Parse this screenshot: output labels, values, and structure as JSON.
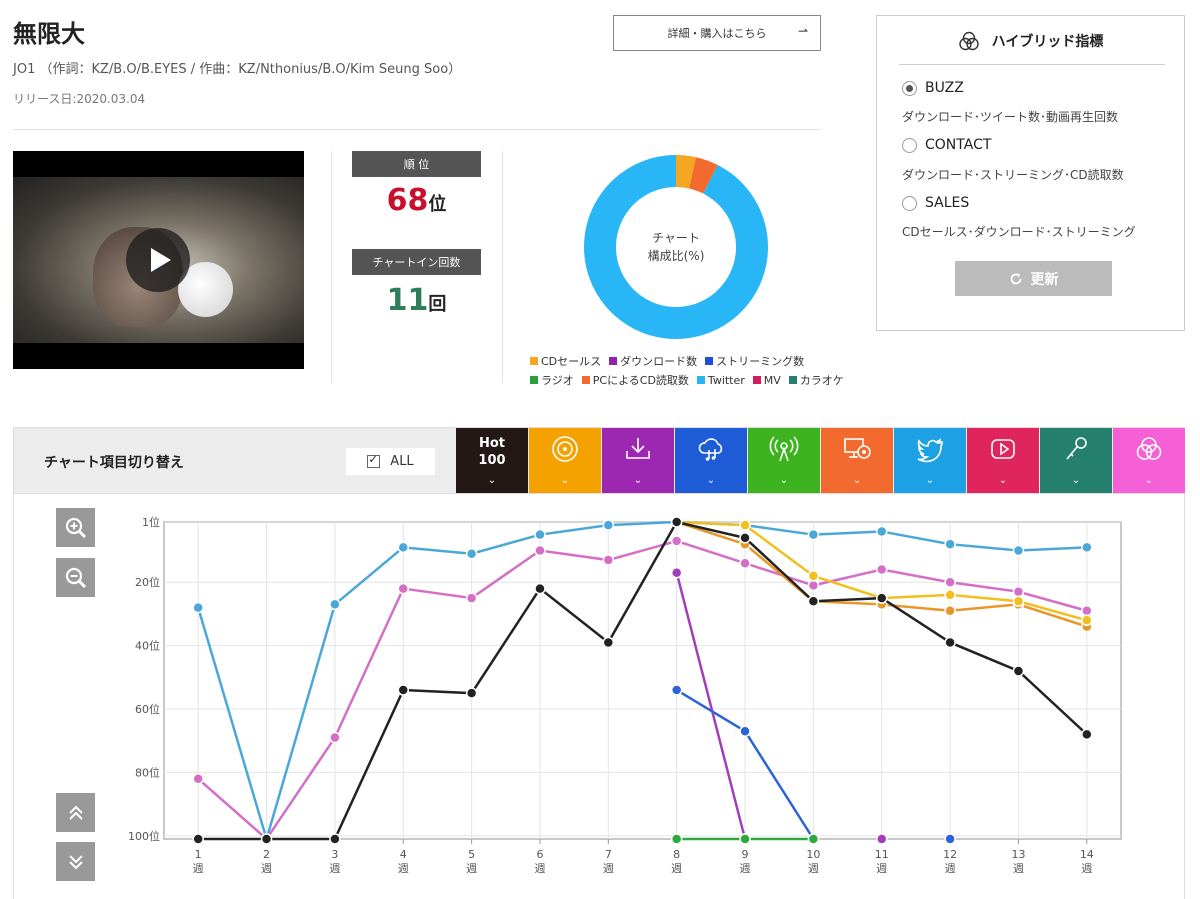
{
  "song": {
    "title": "無限大",
    "credits": "JO1 （作詞：KZ/B.O/B.EYES / 作曲：KZ/Nthonius/B.O/Kim Seung Soo）",
    "release": "リリース日:2020.03.04",
    "detail_button": "詳細・購入はこちら",
    "detail_arrow": "⇀"
  },
  "stats": {
    "rank_label": "順 位",
    "rank_value": "68",
    "rank_unit": "位",
    "chartin_label": "チャートイン回数",
    "chartin_value": "11",
    "chartin_unit": "回",
    "rank_color": "#c8102e",
    "chartin_color": "#2e7d5b"
  },
  "donut": {
    "center_line1": "チャート",
    "center_line2": "構成比(%)",
    "segments": [
      {
        "name": "CDセールス",
        "percent": 3.5,
        "color": "#f5a623"
      },
      {
        "name": "PCによるCD読取数",
        "percent": 4,
        "color": "#f26a2e"
      },
      {
        "name": "Twitter",
        "percent": 92.5,
        "color": "#29b6f6"
      }
    ]
  },
  "legend": [
    {
      "label": "CDセールス",
      "color": "#f5a623"
    },
    {
      "label": "ダウンロード数",
      "color": "#8e24aa"
    },
    {
      "label": "ストリーミング数",
      "color": "#1e4fd8"
    },
    {
      "label": "ラジオ",
      "color": "#2e9e3c"
    },
    {
      "label": "PCによるCD読取数",
      "color": "#f26a2e"
    },
    {
      "label": "Twitter",
      "color": "#29b6f6"
    },
    {
      "label": "MV",
      "color": "#d81b60"
    },
    {
      "label": "カラオケ",
      "color": "#26806e"
    }
  ],
  "hybrid": {
    "title": "ハイブリッド指標",
    "options": [
      {
        "label": "BUZZ",
        "desc": "ダウンロード･ツイート数･動画再生回数",
        "selected": true
      },
      {
        "label": "CONTACT",
        "desc": "ダウンロード･ストリーミング･CD読取数",
        "selected": false
      },
      {
        "label": "SALES",
        "desc": "CDセールス･ダウンロード･ストリーミング",
        "selected": false
      }
    ],
    "update_label": "更新",
    "update_icon": "refresh-icon"
  },
  "toggle": {
    "title": "チャート項目切り替え",
    "all_label": "ALL",
    "tabs": [
      {
        "name": "hot100",
        "label1": "Hot",
        "label2": "100",
        "color": "#231815",
        "icon": "text"
      },
      {
        "name": "cd-sales",
        "color": "#f5a100",
        "icon": "disc-icon"
      },
      {
        "name": "download",
        "color": "#9c27b0",
        "icon": "download-icon"
      },
      {
        "name": "streaming",
        "color": "#1e5bd6",
        "icon": "cloud-music-icon"
      },
      {
        "name": "radio",
        "color": "#3cb31f",
        "icon": "radio-icon"
      },
      {
        "name": "pc-cd-read",
        "color": "#f26a2e",
        "icon": "monitor-disc-icon"
      },
      {
        "name": "twitter",
        "color": "#1da1e4",
        "icon": "twitter-icon"
      },
      {
        "name": "mv",
        "color": "#e0245e",
        "icon": "play-icon"
      },
      {
        "name": "karaoke",
        "color": "#26806e",
        "icon": "microphone-icon"
      },
      {
        "name": "hybrid",
        "color": "#f560d6",
        "icon": "hybrid-icon"
      }
    ]
  },
  "chart_data": {
    "type": "line",
    "x": [
      "1",
      "2",
      "3",
      "4",
      "5",
      "6",
      "7",
      "8",
      "9",
      "10",
      "11",
      "12",
      "13",
      "14"
    ],
    "x_unit": "週",
    "y_ticks": [
      "1位",
      "20位",
      "40位",
      "60位",
      "80位",
      "100位"
    ],
    "y_tick_values": [
      1,
      20,
      40,
      60,
      80,
      100
    ],
    "ylim": [
      1,
      101
    ],
    "y_inverted": true,
    "grid": true,
    "series": [
      {
        "key": "twitter",
        "color": "#4aa8d8",
        "values": [
          28,
          101,
          27,
          9,
          11,
          5,
          2,
          1,
          2,
          5,
          4,
          8,
          10,
          9
        ]
      },
      {
        "key": "mv",
        "color": "#d46fc8",
        "values": [
          82,
          101,
          69,
          22,
          25,
          10,
          13,
          7,
          14,
          21,
          16,
          20,
          23,
          29
        ]
      },
      {
        "key": "pc-cd-read",
        "color": "#e8962a",
        "values": [
          null,
          null,
          null,
          null,
          null,
          null,
          null,
          1,
          8,
          26,
          27,
          29,
          27,
          34
        ]
      },
      {
        "key": "cd-sales",
        "color": "#f2c01e",
        "values": [
          null,
          null,
          null,
          null,
          null,
          null,
          null,
          1,
          2,
          18,
          25,
          24,
          26,
          32
        ]
      },
      {
        "key": "download",
        "color": "#a23dbb",
        "values": [
          null,
          null,
          null,
          null,
          null,
          null,
          null,
          17,
          101,
          null,
          101,
          null,
          null,
          null
        ]
      },
      {
        "key": "streaming",
        "color": "#2b63d8",
        "values": [
          null,
          null,
          null,
          null,
          null,
          null,
          null,
          54,
          67,
          101,
          null,
          101,
          null,
          null
        ]
      },
      {
        "key": "radio",
        "color": "#2eaa3c",
        "values": [
          null,
          null,
          null,
          null,
          null,
          null,
          null,
          101,
          101,
          101,
          null,
          null,
          null,
          null
        ]
      },
      {
        "key": "hot100",
        "color": "#222222",
        "values": [
          101,
          101,
          101,
          54,
          55,
          22,
          39,
          1,
          6,
          26,
          25,
          39,
          48,
          68
        ]
      }
    ]
  }
}
